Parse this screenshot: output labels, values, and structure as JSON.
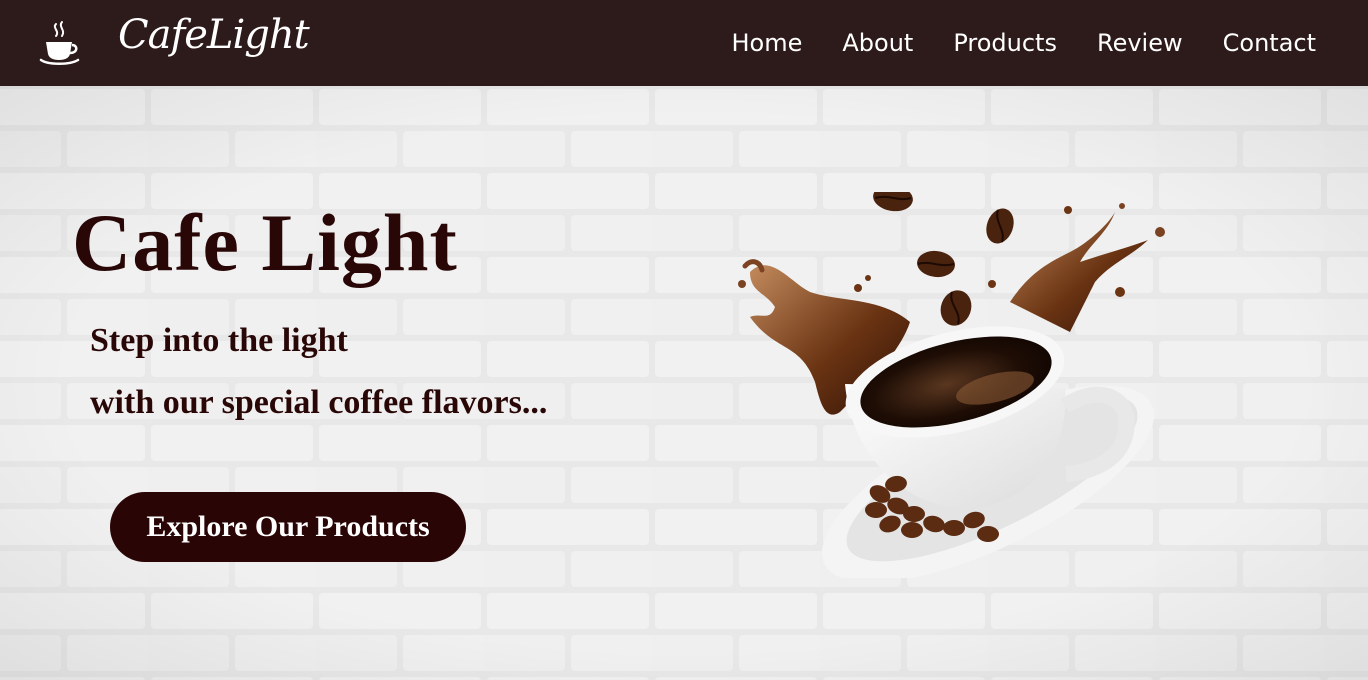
{
  "brand": {
    "name": "CafeLight",
    "icon": "coffee-cup-icon"
  },
  "nav": {
    "items": [
      {
        "label": "Home"
      },
      {
        "label": "About"
      },
      {
        "label": "Products"
      },
      {
        "label": "Review"
      },
      {
        "label": "Contact"
      }
    ]
  },
  "hero": {
    "title": "Cafe Light",
    "subtitle_line1": "Step into the light",
    "subtitle_line2": "with our special coffee flavors...",
    "cta_label": "Explore Our Products",
    "image": "coffee-cup-splash-image"
  },
  "colors": {
    "navbar_bg": "#2d1a1a",
    "text_dark": "#2a0707",
    "button_bg": "#2a0505",
    "wall": "#e9e9e9"
  }
}
